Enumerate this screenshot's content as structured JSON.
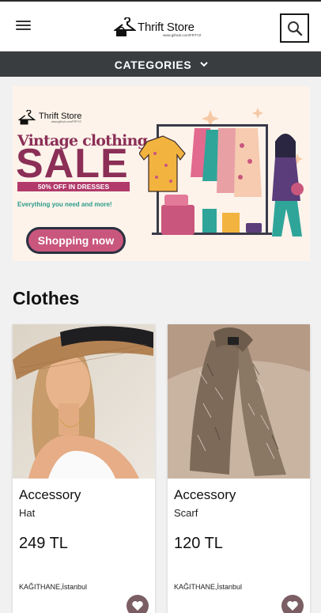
{
  "header": {
    "logo_title": "Thrift Store",
    "logo_subtitle": "www.github.com/FRTYZ",
    "menu_icon": "hamburger-menu-icon",
    "search_icon": "search-icon"
  },
  "categories": {
    "label": "CATEGORIES",
    "icon": "chevron-down-icon"
  },
  "banner": {
    "logo_title": "Thrift Store",
    "logo_subtitle": "www.github.com/FRTYZ",
    "headline": "Vintage clothing",
    "sale": "SALE",
    "offer": "50% OFF IN DRESSES",
    "tagline": "Everything you need and more!",
    "button_label": "Shopping now",
    "colors": {
      "primary": "#8b2f57",
      "button": "#c9567d",
      "tagline": "#2a9a8a",
      "background": "#fdf3ea"
    }
  },
  "section": {
    "title": "Clothes"
  },
  "products": [
    {
      "category": "Accessory",
      "name": "Hat",
      "price": "249 TL",
      "location": "KAĞITHANE,İstanbul",
      "fav_icon": "heart-icon"
    },
    {
      "category": "Accessory",
      "name": "Scarf",
      "price": "120 TL",
      "location": "KAĞITHANE,İstanbul",
      "fav_icon": "heart-icon"
    }
  ]
}
